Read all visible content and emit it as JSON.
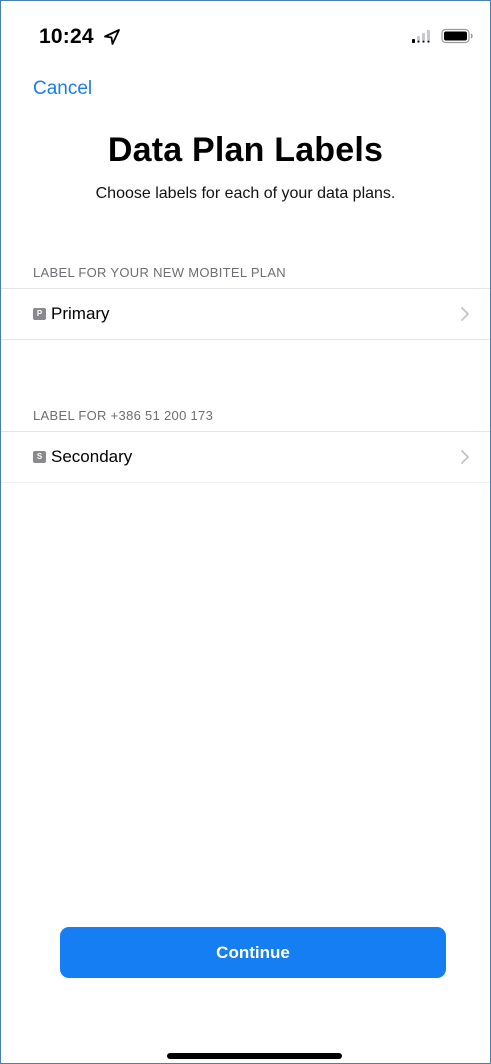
{
  "status_bar": {
    "time": "10:24",
    "location_icon": "location-arrow-icon",
    "signal_icon": "cellular-signal-icon",
    "battery_icon": "battery-icon"
  },
  "nav": {
    "cancel_label": "Cancel"
  },
  "header": {
    "title": "Data Plan Labels",
    "subtitle": "Choose labels for each of your data plans."
  },
  "sections": [
    {
      "header": "LABEL FOR YOUR NEW MOBITEL PLAN",
      "row": {
        "badge": "P",
        "label": "Primary",
        "chevron_icon": "chevron-right-icon"
      }
    },
    {
      "header": "LABEL FOR +386 51 200 173",
      "row": {
        "badge": "S",
        "label": "Secondary",
        "chevron_icon": "chevron-right-icon"
      }
    }
  ],
  "footer": {
    "continue_label": "Continue"
  },
  "colors": {
    "accent": "#157ef2",
    "link": "#1a7df0",
    "section_header": "#6d6d72",
    "badge": "#8a8a8e"
  }
}
